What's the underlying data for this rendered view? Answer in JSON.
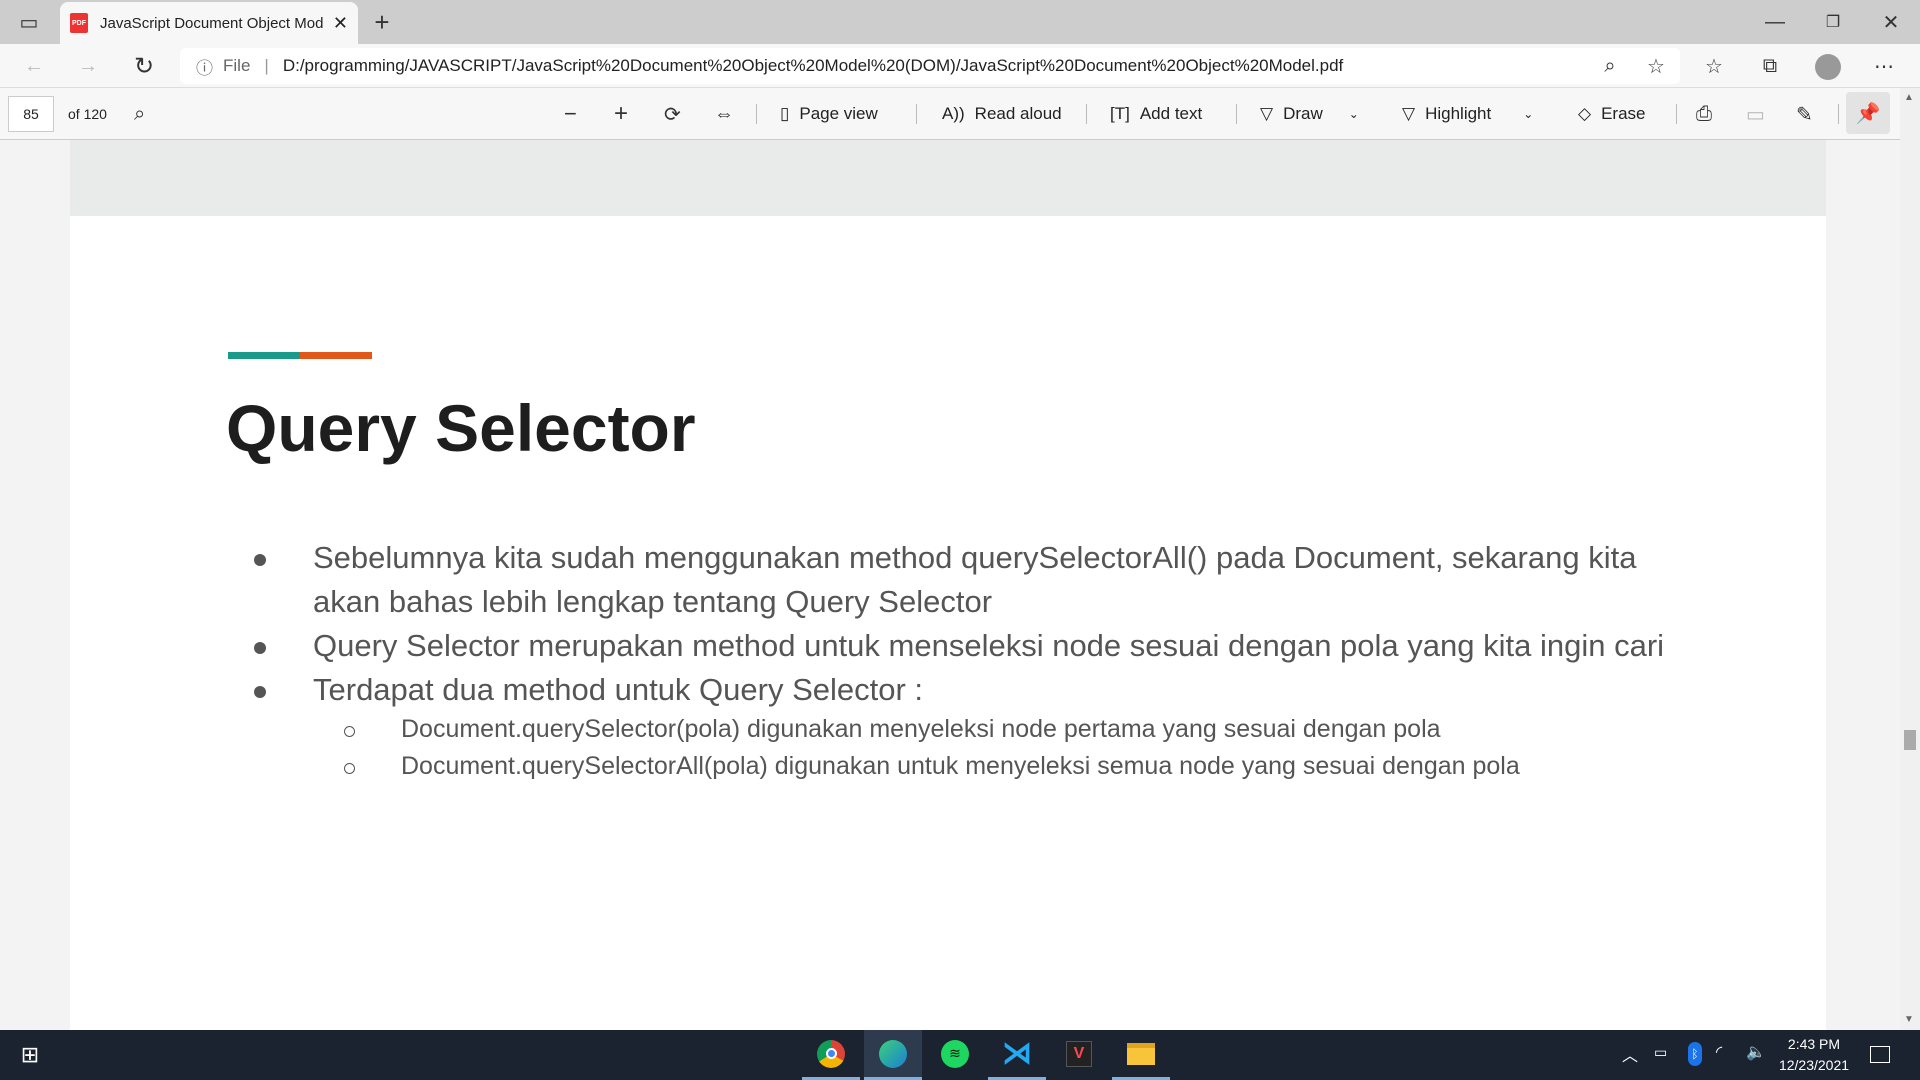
{
  "browser": {
    "tab_title": "JavaScript Document Object Model",
    "url_prefix": "File",
    "url": "D:/programming/JAVASCRIPT/JavaScript%20Document%20Object%20Model%20(DOM)/JavaScript%20Document%20Object%20Model.pdf"
  },
  "pdf_toolbar": {
    "page": "85",
    "of_pages": "of 120",
    "page_view": "Page view",
    "read_aloud": "Read aloud",
    "add_text": "Add text",
    "draw": "Draw",
    "highlight": "Highlight",
    "erase": "Erase"
  },
  "slide": {
    "accent_colors": [
      "#1a9a8a",
      "#e0581a"
    ],
    "title": "Query Selector",
    "bullets": [
      "Sebelumnya kita sudah menggunakan method querySelectorAll() pada Document, sekarang kita",
      "akan bahas lebih lengkap tentang Query Selector",
      "Query Selector merupakan method untuk menseleksi node sesuai dengan pola yang kita ingin cari",
      "Terdapat dua method untuk Query Selector :"
    ],
    "sub_bullets": [
      "Document.querySelector(pola) digunakan menyeleksi node pertama yang sesuai dengan pola",
      "Document.querySelectorAll(pola) digunakan untuk menyeleksi semua node yang sesuai dengan pola"
    ]
  },
  "taskbar": {
    "apps": [
      "chrome",
      "edge",
      "spotify",
      "vscode",
      "valorant",
      "file-explorer"
    ],
    "time": "2:43 PM",
    "date": "12/23/2021"
  }
}
